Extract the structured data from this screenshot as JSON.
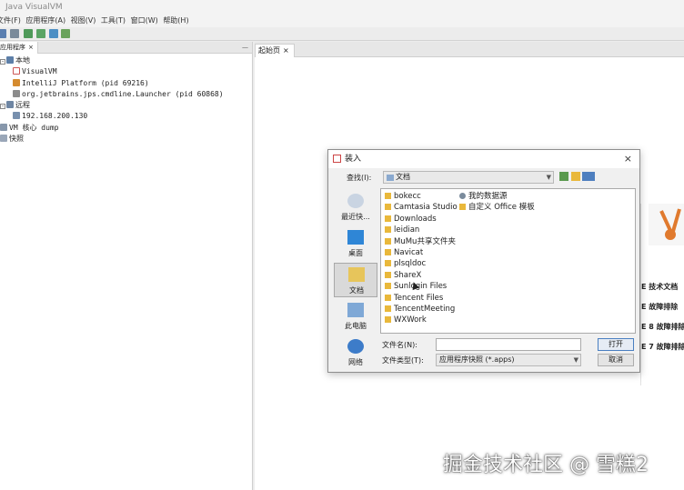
{
  "window": {
    "title": "Java VisualVM"
  },
  "menu": [
    "文件(F)",
    "应用程序(A)",
    "视图(V)",
    "工具(T)",
    "窗口(W)",
    "帮助(H)"
  ],
  "left_panel": {
    "tab_label": "应用程序",
    "tab_close": "×",
    "minimize": "—",
    "tree": [
      {
        "label": "本地",
        "level": 0,
        "expander": "-"
      },
      {
        "label": "VisualVM",
        "level": 1
      },
      {
        "label": "IntelliJ Platform (pid 69216)",
        "level": 1
      },
      {
        "label": "org.jetbrains.jps.cmdline.Launcher (pid 60868)",
        "level": 1
      },
      {
        "label": "远程",
        "level": 0,
        "expander": "-"
      },
      {
        "label": "192.168.200.130",
        "level": 1
      },
      {
        "label": "VM 核心 dump",
        "level": 0
      },
      {
        "label": "快照",
        "level": 0
      }
    ]
  },
  "right_panel": {
    "tab_label": "起始页",
    "tab_close": "×",
    "start_items": [
      "E 技术文档",
      "E 故障排除",
      "E 8 故障排除",
      "E 7 故障排除"
    ]
  },
  "dialog": {
    "title": "装入",
    "close": "×",
    "look_in_label": "查找(I):",
    "look_in_value": "文档",
    "places": [
      {
        "label": "最近快...",
        "icon": "recent-items-icon"
      },
      {
        "label": "桌面",
        "icon": "desktop-icon"
      },
      {
        "label": "文档",
        "icon": "documents-icon",
        "selected": true
      },
      {
        "label": "此电脑",
        "icon": "computer-icon"
      },
      {
        "label": "网络",
        "icon": "network-icon"
      }
    ],
    "files_col1": [
      "bokecc",
      "Camtasia Studio",
      "Downloads",
      "leidian",
      "MuMu共享文件夹",
      "Navicat",
      "plsqldoc",
      "ShareX",
      "Sunlogin Files",
      "Tencent Files",
      "TencentMeeting",
      "WXWork"
    ],
    "files_col2": [
      "我的数据源",
      "自定义 Office 模板"
    ],
    "filename_label": "文件名(N):",
    "filename_value": "",
    "filetype_label": "文件类型(T):",
    "filetype_value": "应用程序快照 (*.apps)",
    "open_label": "打开",
    "cancel_label": "取消"
  },
  "watermark": "掘金技术社区 @ 雪糕2"
}
